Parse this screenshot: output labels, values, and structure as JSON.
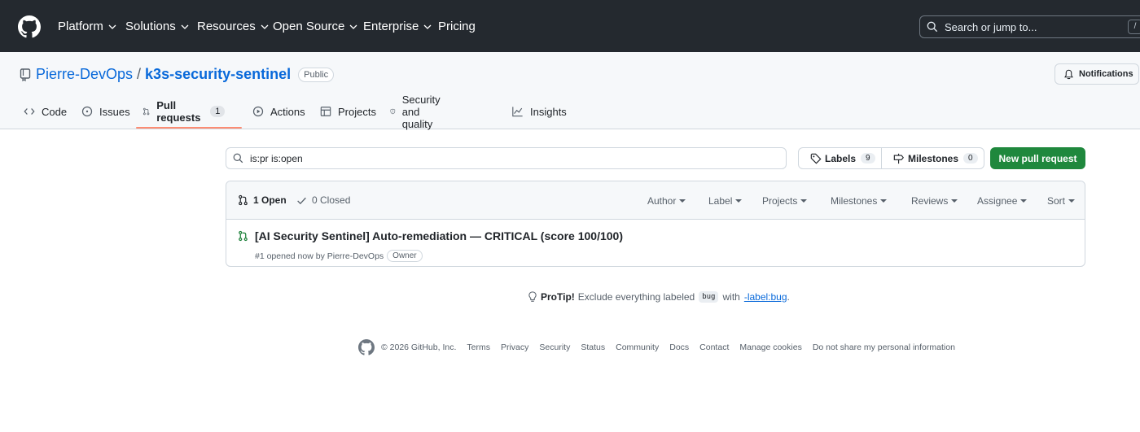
{
  "header": {
    "nav": [
      "Platform",
      "Solutions",
      "Resources",
      "Open Source",
      "Enterprise",
      "Pricing"
    ],
    "search_placeholder": "Search or jump to...",
    "search_shortcut": "/"
  },
  "repo": {
    "owner": "Pierre-DevOps",
    "separator": "/",
    "name": "k3s-security-sentinel",
    "visibility": "Public",
    "notifications_label": "Notifications"
  },
  "tabs": [
    {
      "label": "Code",
      "icon": "code-icon"
    },
    {
      "label": "Issues",
      "icon": "issue-opened-icon"
    },
    {
      "label": "Pull requests",
      "icon": "git-pull-request-icon",
      "count": "1",
      "active": true
    },
    {
      "label": "Actions",
      "icon": "play-icon"
    },
    {
      "label": "Projects",
      "icon": "table-icon"
    },
    {
      "label": "Security and quality",
      "icon": "shield-icon"
    },
    {
      "label": "Insights",
      "icon": "graph-icon"
    }
  ],
  "filters": {
    "query": "is:pr is:open",
    "labels_label": "Labels",
    "labels_count": "9",
    "milestones_label": "Milestones",
    "milestones_count": "0",
    "new_pr_label": "New pull request"
  },
  "list_header": {
    "open_label": "1 Open",
    "closed_label": "0 Closed",
    "dropdowns": [
      "Author",
      "Label",
      "Projects",
      "Milestones",
      "Reviews",
      "Assignee",
      "Sort"
    ]
  },
  "pull_requests": [
    {
      "title": "[AI Security Sentinel] Auto-remediation — CRITICAL (score 100/100)",
      "meta": "#1 opened now by Pierre-DevOps",
      "badge": "Owner"
    }
  ],
  "protip": {
    "lead": "ProTip!",
    "text1": "Exclude everything labeled",
    "code": "bug",
    "text2": "with",
    "link": "-label:bug",
    "end": "."
  },
  "footer": {
    "copyright": "© 2026 GitHub, Inc.",
    "links": [
      "Terms",
      "Privacy",
      "Security",
      "Status",
      "Community",
      "Docs",
      "Contact",
      "Manage cookies",
      "Do not share my personal information"
    ]
  },
  "colors": {
    "header_bg": "#24292f",
    "link": "#0969da",
    "primary_button": "#1f883d",
    "active_tab_underline": "#fd8c73",
    "open_state": "#1a7f37"
  }
}
